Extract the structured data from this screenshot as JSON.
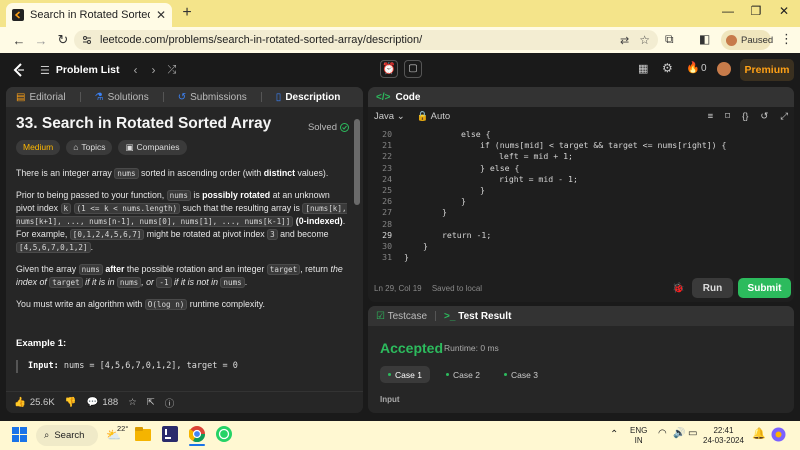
{
  "browser": {
    "tab_title": "Search in Rotated Sorted Array",
    "url": "leetcode.com/problems/search-in-rotated-sorted-array/description/",
    "profile_status": "Paused"
  },
  "header": {
    "problem_list": "Problem List",
    "notification_count": "0",
    "premium": "Premium"
  },
  "left_tabs": [
    "Editorial",
    "Solutions",
    "Submissions",
    "Description"
  ],
  "problem": {
    "title": "33. Search in Rotated Sorted Array",
    "solved": "Solved",
    "tags": {
      "difficulty": "Medium",
      "topics": "Topics",
      "companies": "Companies"
    },
    "p1": [
      "There is an integer array ",
      "nums",
      " sorted in ascending order (with ",
      "distinct",
      " values)."
    ],
    "p2": [
      "Prior to being passed to your function, ",
      "nums",
      " is ",
      "possibly rotated",
      " at an unknown pivot index ",
      "k",
      " ",
      "(1 <= k < nums.length)",
      " such that the resulting array is ",
      "[nums[k], nums[k+1], ..., nums[n-1], nums[0], nums[1], ..., nums[k-1]]",
      " ",
      "(0-indexed)",
      ". For example, ",
      "[0,1,2,4,5,6,7]",
      " might be rotated at pivot index ",
      "3",
      " and become ",
      "[4,5,6,7,0,1,2]",
      "."
    ],
    "p3": [
      "Given the array ",
      "nums",
      " ",
      "after",
      " the possible rotation and an integer ",
      "target",
      ", return ",
      "the index of ",
      "target",
      " if it is in ",
      "nums",
      ", or ",
      "-1",
      " if it is not in ",
      "nums",
      "."
    ],
    "p4": [
      "You must write an algorithm with ",
      "O(log n)",
      " runtime complexity."
    ],
    "example_title": "Example 1:",
    "example_input_label": "Input:",
    "example_input": "nums = [4,5,6,7,0,1,2], target = 0"
  },
  "footer": {
    "likes": "25.6K",
    "comments": "188"
  },
  "code": {
    "title": "Code",
    "language": "Java",
    "mode": "Auto",
    "lines": [
      {
        "n": "20",
        "indent": 3,
        "text": "else {"
      },
      {
        "n": "21",
        "indent": 4,
        "text": "if (nums[mid] < target && target <= nums[right]) {"
      },
      {
        "n": "22",
        "indent": 5,
        "text": "left = mid + 1;"
      },
      {
        "n": "23",
        "indent": 4,
        "text": "} else {"
      },
      {
        "n": "24",
        "indent": 5,
        "text": "right = mid - 1;"
      },
      {
        "n": "25",
        "indent": 4,
        "text": "}"
      },
      {
        "n": "26",
        "indent": 3,
        "text": "}"
      },
      {
        "n": "27",
        "indent": 2,
        "text": "}"
      },
      {
        "n": "28",
        "indent": 0,
        "text": ""
      },
      {
        "n": "29",
        "indent": 2,
        "text": "return -1;"
      },
      {
        "n": "30",
        "indent": 1,
        "text": "}"
      },
      {
        "n": "31",
        "indent": 0,
        "text": "}"
      }
    ],
    "cursor": "Ln 29, Col 19",
    "saved": "Saved to local",
    "run": "Run",
    "submit": "Submit"
  },
  "test": {
    "tabs": [
      "Testcase",
      "Test Result"
    ],
    "status": "Accepted",
    "runtime": "Runtime: 0 ms",
    "cases": [
      "Case 1",
      "Case 2",
      "Case 3"
    ],
    "input_label": "Input"
  },
  "taskbar": {
    "search": "Search",
    "weather": "22°",
    "lang": "ENG",
    "region": "IN",
    "time": "22:41",
    "date": "24-03-2024"
  },
  "colors": {
    "accent": "#ffa116",
    "success": "#2cbb5d",
    "browser_tab": "#f4e48a"
  }
}
